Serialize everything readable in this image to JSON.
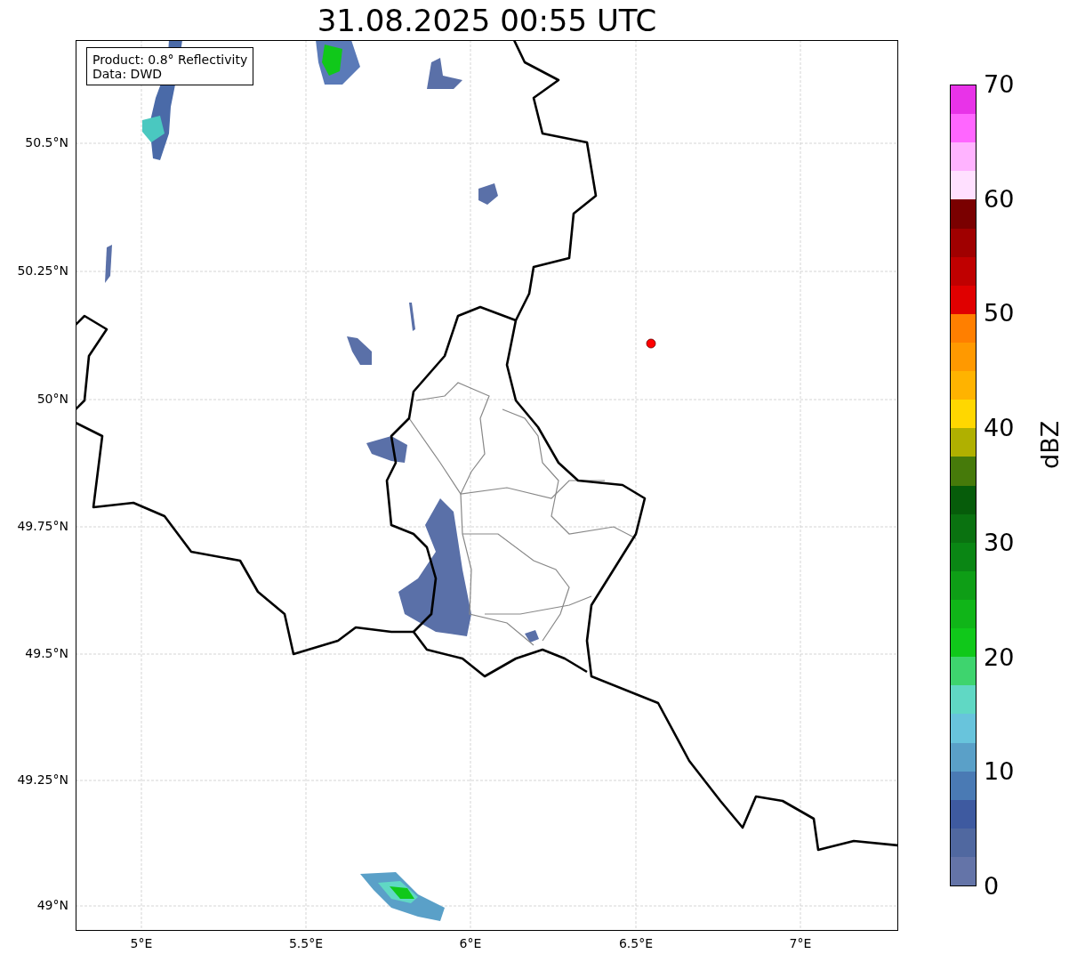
{
  "title": "31.08.2025 00:55 UTC",
  "info_box": {
    "lines": [
      "Product: 0.8° Reflectivity",
      "Data: DWD"
    ]
  },
  "map": {
    "lon_ticks": [
      "5°E",
      "5.5°E",
      "6°E",
      "6.5°E",
      "7°E"
    ],
    "lat_ticks": [
      "50.5°N",
      "50.25°N",
      "50°N",
      "49.75°N",
      "49.5°N",
      "49.25°N",
      "49°N"
    ]
  },
  "colorbar": {
    "label": "dBZ",
    "ticks": [
      "70",
      "60",
      "50",
      "40",
      "30",
      "20",
      "10",
      "0"
    ],
    "bands": [
      {
        "color": "#6474a8"
      },
      {
        "color": "#5068a0"
      },
      {
        "color": "#3e5aa0"
      },
      {
        "color": "#4a7ab4"
      },
      {
        "color": "#5aa0c8"
      },
      {
        "color": "#68c4dc"
      },
      {
        "color": "#60d8c4"
      },
      {
        "color": "#3ed46e"
      },
      {
        "color": "#10c81a"
      },
      {
        "color": "#10b518"
      },
      {
        "color": "#0e9e16"
      },
      {
        "color": "#0a8614"
      },
      {
        "color": "#0a7210"
      },
      {
        "color": "#065c0a"
      },
      {
        "color": "#467a0a"
      },
      {
        "color": "#b0b000"
      },
      {
        "color": "#ffd700"
      },
      {
        "color": "#ffb300"
      },
      {
        "color": "#ff9900"
      },
      {
        "color": "#ff7f00"
      },
      {
        "color": "#e00000"
      },
      {
        "color": "#c00000"
      },
      {
        "color": "#a00000"
      },
      {
        "color": "#7a0000"
      },
      {
        "color": "#ffe0ff"
      },
      {
        "color": "#ffb3ff"
      },
      {
        "color": "#ff66ff"
      },
      {
        "color": "#e833e8"
      }
    ]
  }
}
